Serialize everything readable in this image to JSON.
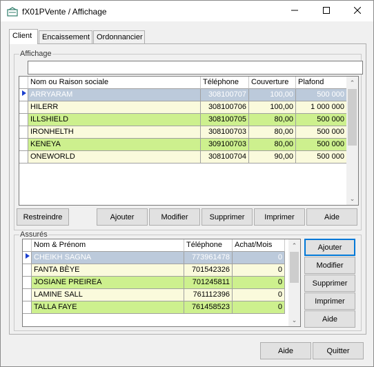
{
  "window": {
    "title": "fX01PVente / Affichage"
  },
  "tabs": [
    "Client",
    "Encaissement",
    "Ordonnancier"
  ],
  "affichage": {
    "legend": "Affichage",
    "filter_value": "",
    "columns": [
      "Nom ou Raison sociale",
      "Téléphone",
      "Couverture",
      "Plafond"
    ],
    "rows": [
      {
        "name": "ARRYARAM",
        "phone": "308100707",
        "cover": "100,00",
        "limit": "500 000",
        "selected": true
      },
      {
        "name": "HILERR",
        "phone": "308100706",
        "cover": "100,00",
        "limit": "1 000 000"
      },
      {
        "name": "ILLSHIELD",
        "phone": "308100705",
        "cover": "80,00",
        "limit": "500 000"
      },
      {
        "name": "IRONHELTH",
        "phone": "308100703",
        "cover": "80,00",
        "limit": "500 000"
      },
      {
        "name": "KENEYA",
        "phone": "309100703",
        "cover": "80,00",
        "limit": "500 000"
      },
      {
        "name": "ONEWORLD",
        "phone": "308100704",
        "cover": "90,00",
        "limit": "500 000"
      }
    ],
    "buttons": [
      "Restreindre",
      "Ajouter",
      "Modifier",
      "Supprimer",
      "Imprimer",
      "Aide"
    ]
  },
  "assures": {
    "legend": "Assurés",
    "columns": [
      "Nom & Prénom",
      "Téléphone",
      "Achat/Mois"
    ],
    "rows": [
      {
        "name": "CHEIKH SAGNA",
        "phone": "773961478",
        "achat": "0",
        "selected": true
      },
      {
        "name": "FANTA BÈYE",
        "phone": "701542326",
        "achat": "0"
      },
      {
        "name": "JOSIANE PREIREA",
        "phone": "701245811",
        "achat": "0"
      },
      {
        "name": "LAMINE SALL",
        "phone": "761112396",
        "achat": "0"
      },
      {
        "name": "TALLA FAYE",
        "phone": "761458523",
        "achat": "0"
      }
    ],
    "buttons": [
      "Ajouter",
      "Modifier",
      "Supprimer",
      "Imprimer",
      "Aide"
    ]
  },
  "footer": {
    "help": "Aide",
    "quit": "Quitter"
  },
  "colors": {
    "selected_row": "#bccadb",
    "row_green": "#cdf08e",
    "row_cream": "#fafadc",
    "accent": "#0078d7"
  }
}
